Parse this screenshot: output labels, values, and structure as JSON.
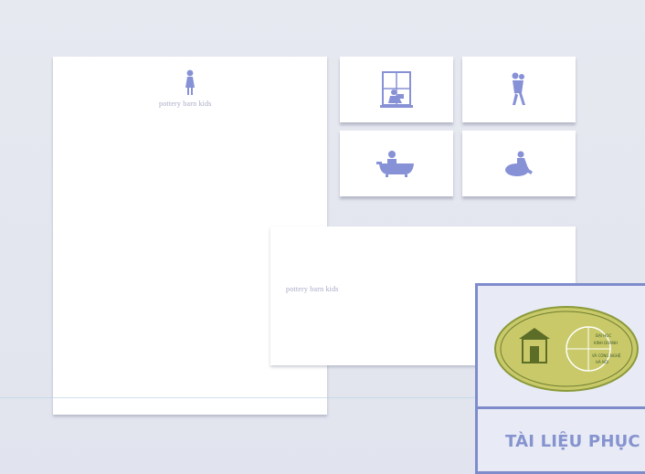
{
  "brand_name": "pottery barn kids",
  "stamp": {
    "caption": "TÀI LIỆU PHỤC V",
    "seal_lines": [
      "ĐẠI HỌC",
      "KINH DOANH",
      "VÀ CÔNG NGHỆ",
      "HÀ NỘI"
    ]
  },
  "cards": [
    {
      "icon": "child-reading-window-icon"
    },
    {
      "icon": "child-with-teddy-bear-icon"
    },
    {
      "icon": "child-in-bathtub-icon"
    },
    {
      "icon": "child-on-beanbag-icon"
    }
  ],
  "colors": {
    "accent": "#8791d6",
    "background": "#e6e8f0",
    "stamp_border": "#7e8ccc",
    "seal_fill": "#c9c96a"
  }
}
